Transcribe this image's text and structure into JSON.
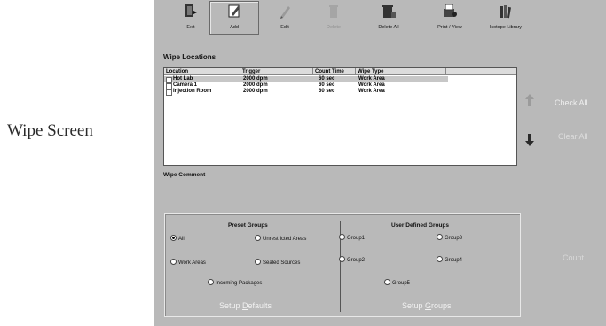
{
  "caption": "Wipe Screen",
  "toolbar": [
    {
      "label": "Exit",
      "icon": "exit-icon"
    },
    {
      "label": "Add",
      "icon": "add-icon"
    },
    {
      "label": "Edit",
      "icon": "edit-icon"
    },
    {
      "label": "Delete",
      "icon": "delete-icon"
    },
    {
      "label": "Delete All",
      "icon": "delete-all-icon"
    },
    {
      "label": "Print / View",
      "icon": "print-view-icon"
    },
    {
      "label": "Isotope Library",
      "icon": "isotope-library-icon"
    }
  ],
  "locations": {
    "title": "Wipe Locations",
    "columns": [
      "Location",
      "Trigger",
      "Count Time",
      "Wipe Type"
    ],
    "rows": [
      [
        "Hot Lab",
        "2000 dpm",
        "60 sec",
        "Work Area"
      ],
      [
        "Camera 1",
        "2000 dpm",
        "60 sec",
        "Work Area"
      ],
      [
        "Injection Room",
        "2000 dpm",
        "60 sec",
        "Work Area"
      ]
    ]
  },
  "side": {
    "check_all": "Check All",
    "clear_all": "Clear All",
    "count": "Count"
  },
  "comment": {
    "title": "Wipe Comment"
  },
  "preset": {
    "title": "Preset Groups",
    "options": [
      "All",
      "Unrestricted Areas",
      "Work Areas",
      "Sealed Sources",
      "Incoming Packages"
    ],
    "setup_prefix": "Setup ",
    "setup_key": "D",
    "setup_rest": "efaults"
  },
  "user": {
    "title": "User Defined Groups",
    "options": [
      "Group1",
      "Group3",
      "Group2",
      "Group4",
      "Group5"
    ],
    "setup_prefix": "Setup ",
    "setup_key": "G",
    "setup_rest": "roups"
  }
}
